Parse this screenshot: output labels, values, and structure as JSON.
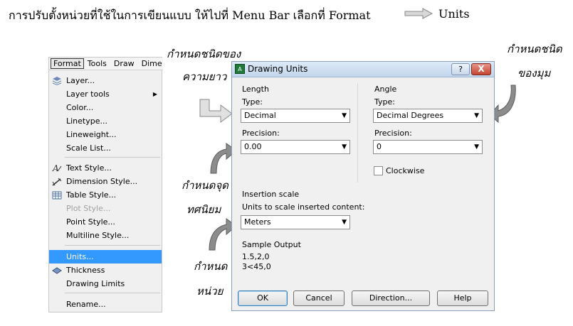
{
  "heading": {
    "text": "การปรับตั้งหน่วยที่ใช้ในการเขียนแบบ  ให้ไปที่ Menu Bar เลือกที่ Format",
    "target": "Units"
  },
  "notes": {
    "length_type_1": "กำหนดชนิดของ",
    "length_type_2": "ความยาว",
    "angle_type_1": "กำหนดชนิด",
    "angle_type_2": "ของมุม",
    "precision_1": "กำหนดจุด",
    "precision_2": "ทศนิยม",
    "units_1": "กำหนด",
    "units_2": "หน่วย"
  },
  "menu": {
    "bar": [
      "Format",
      "Tools",
      "Draw",
      "Dime"
    ],
    "items": [
      {
        "label": "Layer...",
        "icon": "layers-icon"
      },
      {
        "label": "Layer tools",
        "submenu": true
      },
      {
        "label": "Color..."
      },
      {
        "label": "Linetype..."
      },
      {
        "label": "Lineweight..."
      },
      {
        "label": "Scale List..."
      },
      {
        "label": "Text Style...",
        "icon": "text-style-icon"
      },
      {
        "label": "Dimension Style...",
        "icon": "dimension-style-icon"
      },
      {
        "label": "Table Style...",
        "icon": "table-style-icon"
      },
      {
        "label": "Plot Style...",
        "disabled": true
      },
      {
        "label": "Point Style..."
      },
      {
        "label": "Multiline Style..."
      },
      {
        "label": "Units...",
        "selected": true
      },
      {
        "label": "Thickness",
        "icon": "thickness-icon"
      },
      {
        "label": "Drawing Limits"
      },
      {
        "label": "Rename..."
      }
    ]
  },
  "dialog": {
    "title": "Drawing Units",
    "help": "?",
    "close": "X",
    "length": {
      "group": "Length",
      "type_label": "Type:",
      "type_value": "Decimal",
      "precision_label": "Precision:",
      "precision_value": "0.00"
    },
    "angle": {
      "group": "Angle",
      "type_label": "Type:",
      "type_value": "Decimal Degrees",
      "precision_label": "Precision:",
      "precision_value": "0",
      "clockwise": "Clockwise"
    },
    "insertion": {
      "group": "Insertion scale",
      "label": "Units to scale inserted content:",
      "value": "Meters"
    },
    "sample": {
      "group": "Sample Output",
      "line1": "1.5,2,0",
      "line2": "3<45,0"
    },
    "buttons": {
      "ok": "OK",
      "cancel": "Cancel",
      "direction": "Direction...",
      "help": "Help"
    }
  }
}
